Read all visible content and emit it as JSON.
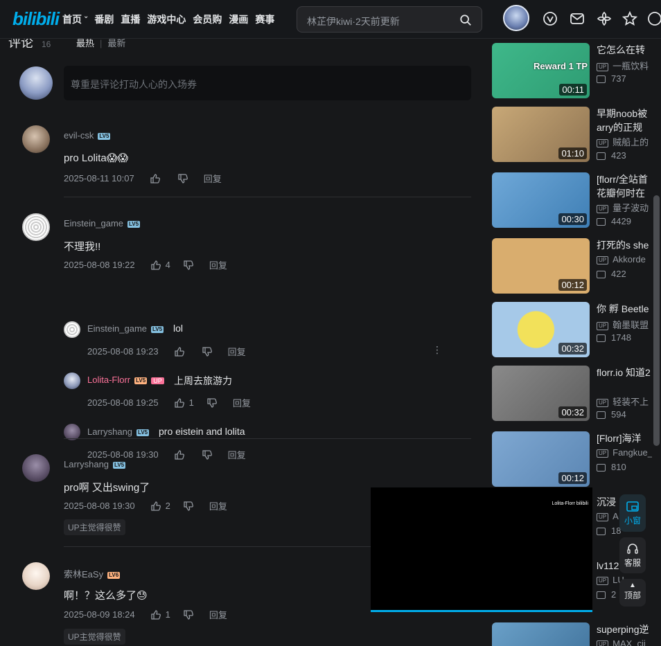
{
  "topbar": {
    "logo": "bilibili",
    "nav": [
      "首页",
      "番剧",
      "直播",
      "游戏中心",
      "会员购",
      "漫画",
      "赛事"
    ],
    "search_placeholder": "林芷伊kiwi·2天前更新"
  },
  "comments": {
    "title": "评论",
    "count": "16",
    "sort_hot": "最热",
    "sort_new": "最新",
    "input_placeholder": "尊重是评论打动人心的入场券",
    "items": [
      {
        "user": "evil-csk",
        "level": "LV5",
        "text": "pro Lolita😱😱",
        "time": "2025-08-11 10:07",
        "likes": "",
        "reply": "回复"
      },
      {
        "user": "Einstein_game",
        "level": "LV5",
        "text": "不理我!!",
        "time": "2025-08-08 19:22",
        "likes": "4",
        "reply": "回复",
        "replies": [
          {
            "user": "Einstein_game",
            "level": "LV5",
            "text": "lol",
            "time": "2025-08-08 19:23",
            "likes": "",
            "reply": "回复"
          },
          {
            "user": "Lolita-Florr",
            "level": "LV5",
            "up": "UP",
            "text": "上周去旅游力",
            "time": "2025-08-08 19:25",
            "likes": "1",
            "reply": "回复"
          },
          {
            "user": "Larryshang",
            "level": "LV5",
            "text": "pro eistein and lolita",
            "time": "2025-08-08 19:30",
            "likes": "",
            "reply": "回复"
          }
        ]
      },
      {
        "user": "Larryshang",
        "level": "LV5",
        "text": "pro啊 又出swing了",
        "time": "2025-08-08 19:30",
        "likes": "2",
        "reply": "回复",
        "badge": "UP主觉得很赞"
      },
      {
        "user": "索林EaSy",
        "level": "LV6",
        "text": "啊！？这么多了😓",
        "time": "2025-08-09 18:24",
        "likes": "1",
        "reply": "回复",
        "badge": "UP主觉得很赞"
      }
    ]
  },
  "sidebar": {
    "videos": [
      {
        "title": "它怎么在转",
        "up": "一瓶饮料",
        "views": "737",
        "duration": "00:11",
        "thumb_text": "Reward 1 TP"
      },
      {
        "title": "早期noob被arry的正规",
        "up": "贼船上的",
        "views": "423",
        "duration": "01:10"
      },
      {
        "title": "[florr/全站首花瓣何时在",
        "up": "量子波动",
        "views": "4429",
        "duration": "00:30"
      },
      {
        "title": "打死的s she",
        "up": "Akkorde",
        "views": "422",
        "duration": "00:12"
      },
      {
        "title": "你 孵 Beetle",
        "up": "翰墨联盟",
        "views": "1748",
        "duration": "00:32"
      },
      {
        "title": "florr.io 知道2",
        "up": "轻装不上",
        "views": "594",
        "duration": "00:32"
      },
      {
        "title": "[Florr]海洋",
        "up": "Fangkue_",
        "views": "810",
        "duration": "00:12"
      },
      {
        "title": "沉浸",
        "up": "A",
        "views": "18",
        "duration": ""
      },
      {
        "title": "lv112",
        "up": "LU",
        "views": "2",
        "duration": ""
      },
      {
        "title": "superping逆",
        "up": "MAX_cii",
        "views": "",
        "duration": ""
      }
    ]
  },
  "mini_player": {
    "watermark": "Lolita-Florr bilibili"
  },
  "float_buttons": {
    "mini": "小窗",
    "service": "客服",
    "top": "顶部"
  },
  "colors": {
    "accent": "#00aeec",
    "pink": "#fb7299",
    "bg": "#17181a"
  }
}
